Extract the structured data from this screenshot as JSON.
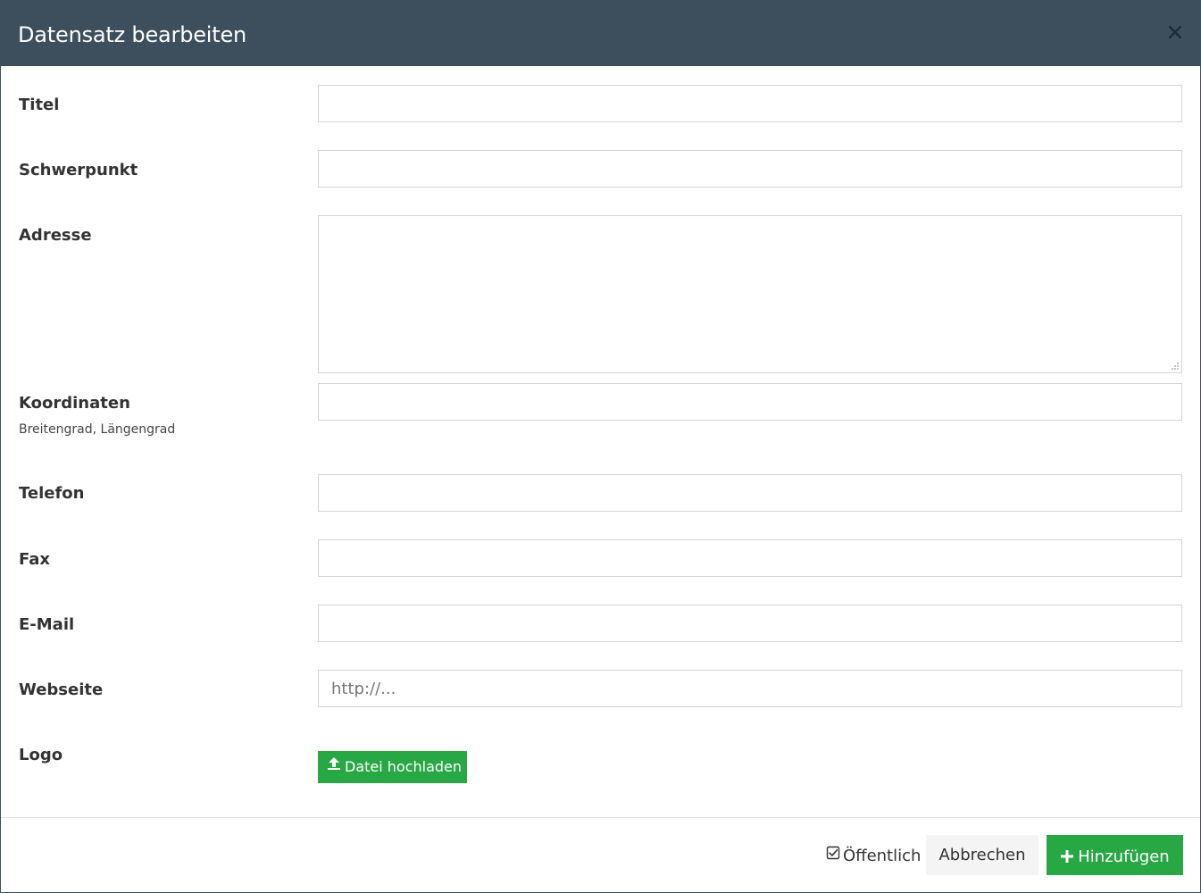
{
  "dialog": {
    "title": "Datensatz bearbeiten",
    "close_icon": "close-icon"
  },
  "form": {
    "title_label": "Titel",
    "focus_label": "Schwerpunkt",
    "address_label": "Adresse",
    "coordinates_label": "Koordinaten",
    "coordinates_hint": "Breitengrad, Längengrad",
    "phone_label": "Telefon",
    "fax_label": "Fax",
    "email_label": "E-Mail",
    "website_label": "Webseite",
    "website_placeholder": "http://...",
    "logo_label": "Logo",
    "upload_label": "Datei hochladen",
    "upload_icon": "upload-icon",
    "values": {
      "title": "",
      "focus": "",
      "address": "",
      "coordinates": "",
      "phone": "",
      "fax": "",
      "email": "",
      "website": ""
    }
  },
  "footer": {
    "public_label": "Öffentlich",
    "public_checked": true,
    "cancel_label": "Abbrechen",
    "add_label": "Hinzufügen",
    "add_icon": "plus-icon"
  },
  "colors": {
    "header_bg": "#3d4f5d",
    "primary_green": "#28a745",
    "cancel_bg": "#f4f4f4"
  }
}
